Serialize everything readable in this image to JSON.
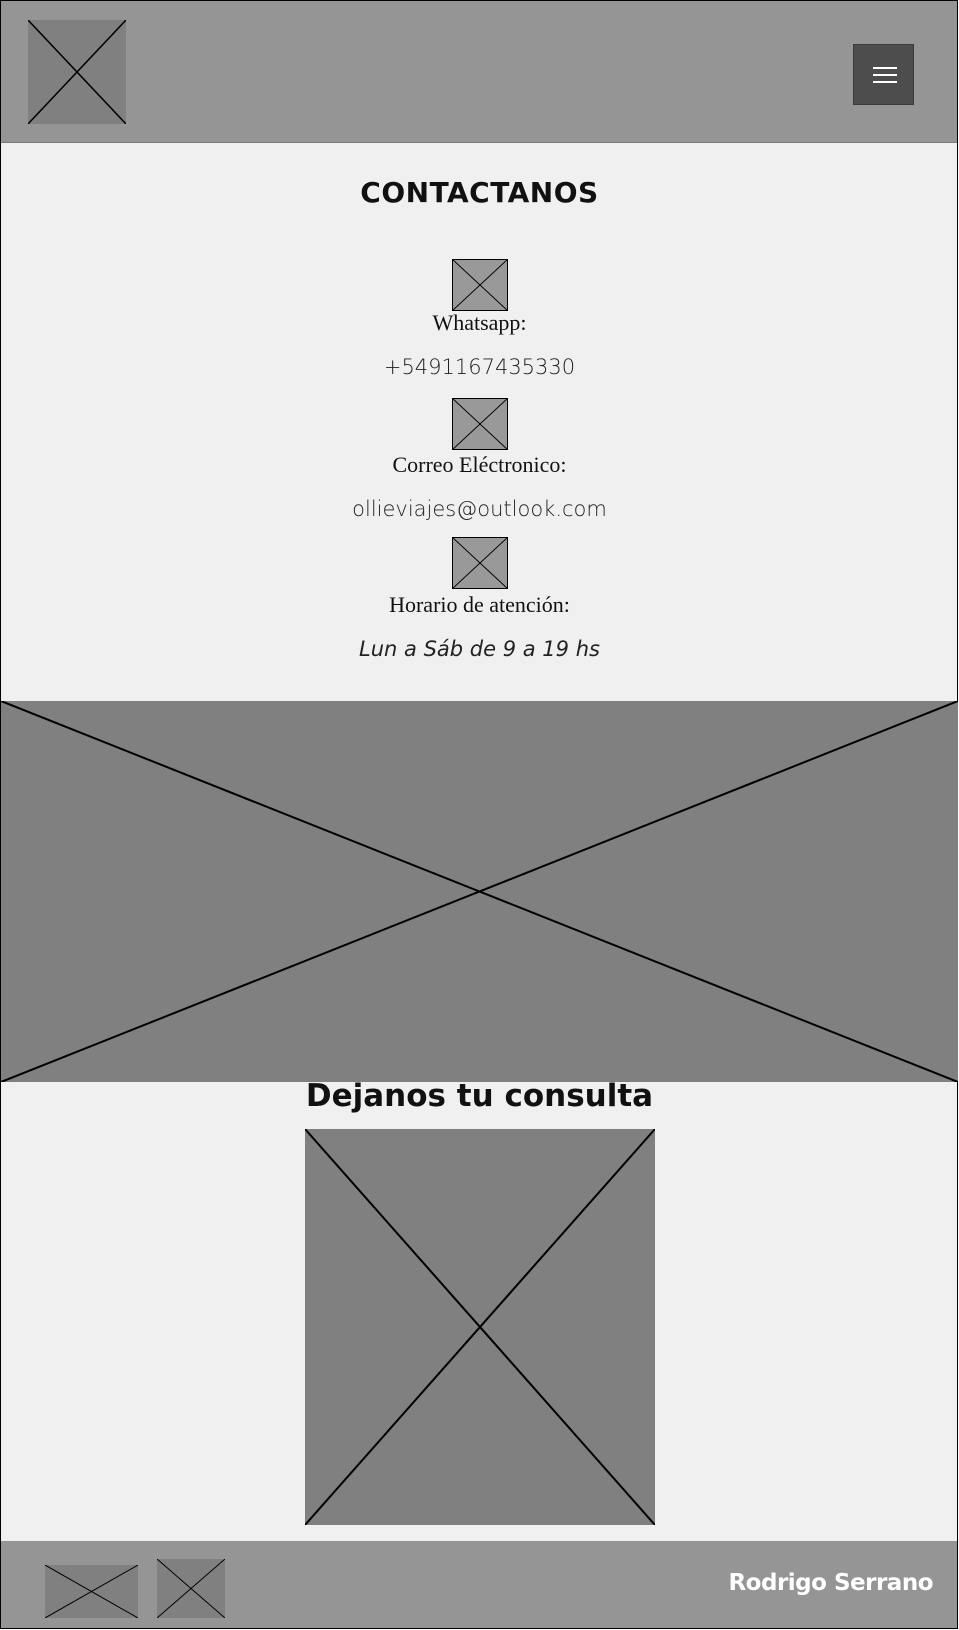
{
  "header": {
    "logo_icon": "logo-placeholder-icon",
    "menu_icon": "hamburger-menu-icon"
  },
  "contact": {
    "title": "CONTACTANOS",
    "items": [
      {
        "icon": "whatsapp-icon",
        "label": "Whatsapp:",
        "value": "+5491167435330"
      },
      {
        "icon": "email-icon",
        "label": "Correo Eléctronico:",
        "value": "ollieviajes@outlook.com"
      },
      {
        "icon": "clock-icon",
        "label": "Horario de atención:",
        "value": "Lun a Sáb de 9 a 19 hs"
      }
    ]
  },
  "consulta": {
    "title": "Dejanos tu consulta"
  },
  "footer": {
    "social_icons": [
      "social-icon-1",
      "social-icon-2"
    ],
    "author": "Rodrigo Serrano"
  },
  "colors": {
    "header_bg": "#959595",
    "page_bg": "#f0f0f0",
    "placeholder": "#808080",
    "menu_button": "#4d4d4d"
  }
}
